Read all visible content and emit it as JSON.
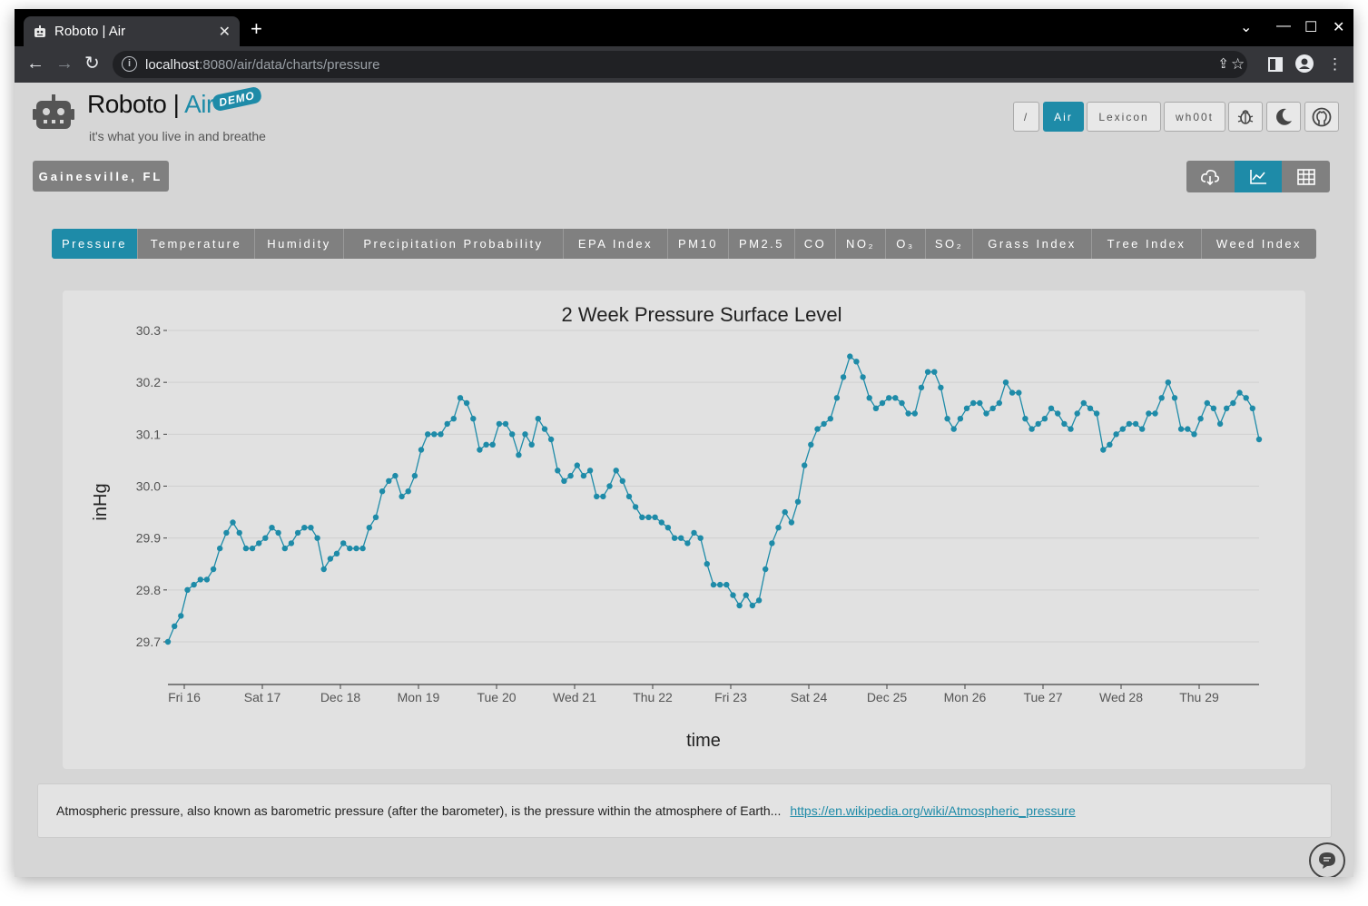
{
  "browser": {
    "tab_title": "Roboto | Air",
    "url_host": "localhost",
    "url_rest": ":8080/air/data/charts/pressure"
  },
  "header": {
    "brand_main": "Roboto | ",
    "brand_air": "Air",
    "demo_badge": "DEMO",
    "tagline": "it's what you live in and breathe",
    "nav": [
      "/",
      "Air",
      "Lexicon",
      "wh00t"
    ]
  },
  "location": "Gainesville, FL",
  "tabs": [
    "Pressure",
    "Temperature",
    "Humidity",
    "Precipitation Probability",
    "EPA Index",
    "PM10",
    "PM2.5",
    "CO",
    "NO₂",
    "O₃",
    "SO₂",
    "Grass Index",
    "Tree Index",
    "Weed Index"
  ],
  "description": {
    "text": "Atmospheric pressure, also known as barometric pressure (after the barometer), is the pressure within the atmosphere of Earth...",
    "link": "https://en.wikipedia.org/wiki/Atmospheric_pressure"
  },
  "colors": {
    "accent": "#1e8ba8",
    "button": "#808080"
  },
  "chart_data": {
    "type": "line",
    "title": "2 Week Pressure Surface Level",
    "xlabel": "time",
    "ylabel": "inHg",
    "ylim": [
      29.62,
      30.33
    ],
    "yticks": [
      "29.7",
      "29.8",
      "29.9",
      "30.0",
      "30.1",
      "30.2",
      "30.3"
    ],
    "xticks": [
      "Fri 16",
      "Sat 17",
      "Dec 18",
      "Mon 19",
      "Tue 20",
      "Wed 21",
      "Thu 22",
      "Fri 23",
      "Sat 24",
      "Dec 25",
      "Mon 26",
      "Tue 27",
      "Wed 28",
      "Thu 29"
    ],
    "grid": true,
    "series": [
      {
        "values": [
          29.7,
          29.73,
          29.75,
          29.8,
          29.81,
          29.82,
          29.82,
          29.84,
          29.88,
          29.91,
          29.93,
          29.91,
          29.88,
          29.88,
          29.89,
          29.9,
          29.92,
          29.91,
          29.88,
          29.89,
          29.91,
          29.92,
          29.92,
          29.9,
          29.84,
          29.86,
          29.87,
          29.89,
          29.88,
          29.88,
          29.88,
          29.92,
          29.94,
          29.99,
          30.01,
          30.02,
          29.98,
          29.99,
          30.02,
          30.07,
          30.1,
          30.1,
          30.1,
          30.12,
          30.13,
          30.17,
          30.16,
          30.13,
          30.07,
          30.08,
          30.08,
          30.12,
          30.12,
          30.1,
          30.06,
          30.1,
          30.08,
          30.13,
          30.11,
          30.09,
          30.03,
          30.01,
          30.02,
          30.04,
          30.02,
          30.03,
          29.98,
          29.98,
          30.0,
          30.03,
          30.01,
          29.98,
          29.96,
          29.94,
          29.94,
          29.94,
          29.93,
          29.92,
          29.9,
          29.9,
          29.89,
          29.91,
          29.9,
          29.85,
          29.81,
          29.81,
          29.81,
          29.79,
          29.77,
          29.79,
          29.77,
          29.78,
          29.84,
          29.89,
          29.92,
          29.95,
          29.93,
          29.97,
          30.04,
          30.08,
          30.11,
          30.12,
          30.13,
          30.17,
          30.21,
          30.25,
          30.24,
          30.21,
          30.17,
          30.15,
          30.16,
          30.17,
          30.17,
          30.16,
          30.14,
          30.14,
          30.19,
          30.22,
          30.22,
          30.19,
          30.13,
          30.11,
          30.13,
          30.15,
          30.16,
          30.16,
          30.14,
          30.15,
          30.16,
          30.2,
          30.18,
          30.18,
          30.13,
          30.11,
          30.12,
          30.13,
          30.15,
          30.14,
          30.12,
          30.11,
          30.14,
          30.16,
          30.15,
          30.14,
          30.07,
          30.08,
          30.1,
          30.11,
          30.12,
          30.12,
          30.11,
          30.14,
          30.14,
          30.17,
          30.2,
          30.17,
          30.11,
          30.11,
          30.1,
          30.13,
          30.16,
          30.15,
          30.12,
          30.15,
          30.16,
          30.18,
          30.17,
          30.15,
          30.09
        ]
      }
    ]
  }
}
